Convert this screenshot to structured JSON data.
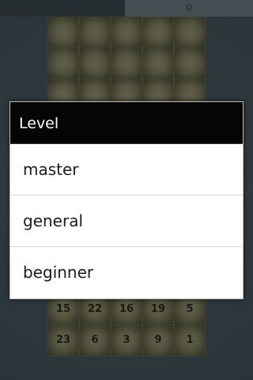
{
  "scores": {
    "left": "0",
    "right": "0"
  },
  "board": {
    "rows": [
      [
        "",
        "",
        "",
        "",
        ""
      ],
      [
        "",
        "",
        "",
        "",
        ""
      ],
      [
        "",
        "",
        "",
        "",
        ""
      ],
      [
        "",
        "",
        "",
        "",
        ""
      ],
      [
        "",
        "",
        "",
        "",
        ""
      ],
      [
        "",
        "",
        "",
        "",
        ""
      ],
      [
        "",
        "",
        "",
        "",
        ""
      ],
      [
        "",
        "",
        "",
        "",
        ""
      ],
      [
        "",
        "",
        "",
        "",
        ""
      ],
      [
        "15",
        "22",
        "16",
        "19",
        "5"
      ],
      [
        "23",
        "6",
        "3",
        "9",
        "1"
      ]
    ]
  },
  "dialog": {
    "title": "Level",
    "options": [
      "master",
      "general",
      "beginner"
    ]
  }
}
